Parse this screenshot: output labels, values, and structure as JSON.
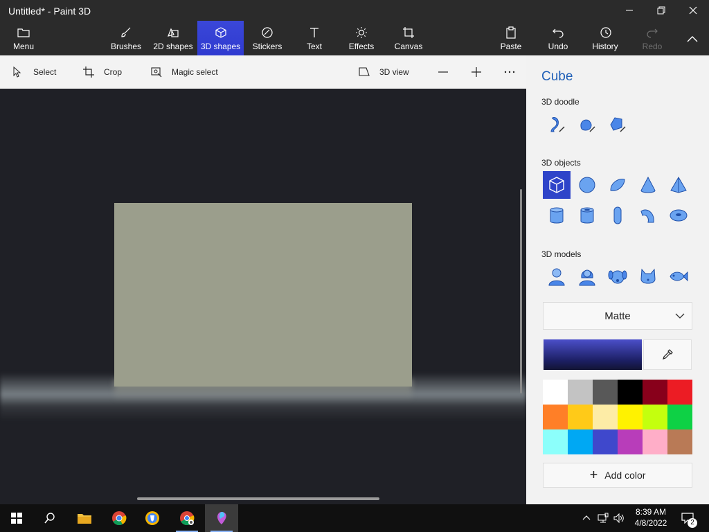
{
  "window": {
    "title": "Untitled* - Paint 3D"
  },
  "toolbar": {
    "menu": "Menu",
    "brushes": "Brushes",
    "shapes2d": "2D shapes",
    "shapes3d": "3D shapes",
    "stickers": "Stickers",
    "text": "Text",
    "effects": "Effects",
    "canvas": "Canvas",
    "paste": "Paste",
    "undo": "Undo",
    "history": "History",
    "redo": "Redo"
  },
  "subbar": {
    "select": "Select",
    "crop": "Crop",
    "magic_select": "Magic select",
    "view3d": "3D view"
  },
  "panel": {
    "title": "Cube",
    "doodle_label": "3D doodle",
    "objects_label": "3D objects",
    "models_label": "3D models",
    "material": "Matte",
    "add_color": "Add color",
    "current_color": "#2a2d8f",
    "palette": [
      "#ffffff",
      "#c3c3c3",
      "#585858",
      "#000000",
      "#88001b",
      "#ec1c24",
      "#ff7f27",
      "#ffca18",
      "#fdeca6",
      "#fff200",
      "#c4ff0e",
      "#0ed145",
      "#8cfffb",
      "#00a8f3",
      "#3f48cc",
      "#b83dba",
      "#ffaec8",
      "#b97a56"
    ]
  },
  "taskbar": {
    "time": "8:39 AM",
    "date": "4/8/2022",
    "notifications": "2"
  },
  "accent": "#2f3ad0"
}
